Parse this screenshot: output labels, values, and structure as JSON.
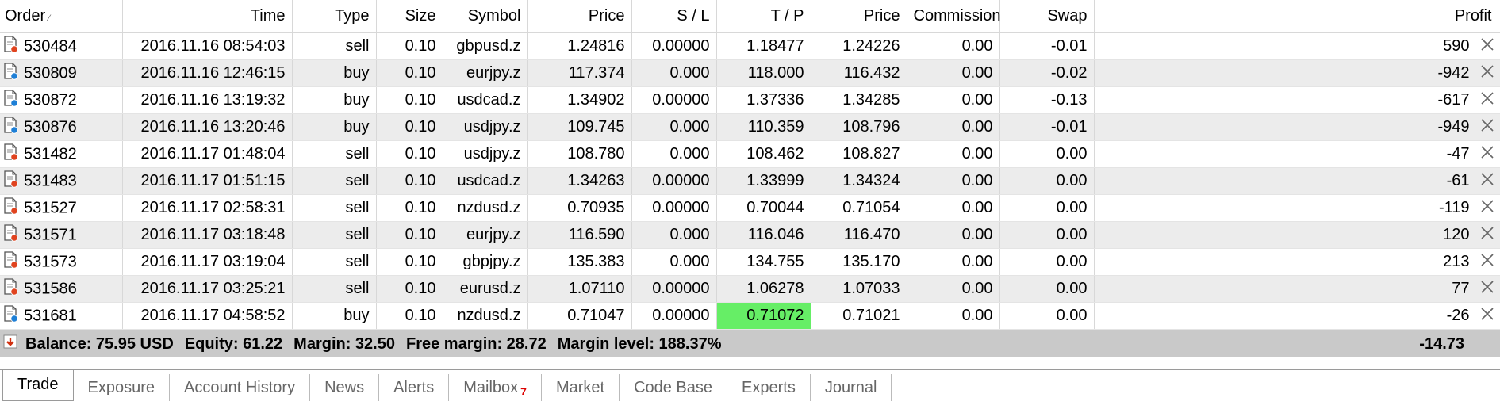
{
  "columns": [
    "Order",
    "Time",
    "Type",
    "Size",
    "Symbol",
    "Price",
    "S / L",
    "T / P",
    "Price",
    "Commission",
    "Swap",
    "Profit"
  ],
  "rows": [
    {
      "order": "530484",
      "time": "2016.11.16 08:54:03",
      "type": "sell",
      "size": "0.10",
      "symbol": "gbpusd.z",
      "price": "1.24816",
      "sl": "0.00000",
      "tp": "1.18477",
      "cur": "1.24226",
      "commission": "0.00",
      "swap": "-0.01",
      "profit": "590"
    },
    {
      "order": "530809",
      "time": "2016.11.16 12:46:15",
      "type": "buy",
      "size": "0.10",
      "symbol": "eurjpy.z",
      "price": "117.374",
      "sl": "0.000",
      "tp": "118.000",
      "cur": "116.432",
      "commission": "0.00",
      "swap": "-0.02",
      "profit": "-942"
    },
    {
      "order": "530872",
      "time": "2016.11.16 13:19:32",
      "type": "buy",
      "size": "0.10",
      "symbol": "usdcad.z",
      "price": "1.34902",
      "sl": "0.00000",
      "tp": "1.37336",
      "cur": "1.34285",
      "commission": "0.00",
      "swap": "-0.13",
      "profit": "-617"
    },
    {
      "order": "530876",
      "time": "2016.11.16 13:20:46",
      "type": "buy",
      "size": "0.10",
      "symbol": "usdjpy.z",
      "price": "109.745",
      "sl": "0.000",
      "tp": "110.359",
      "cur": "108.796",
      "commission": "0.00",
      "swap": "-0.01",
      "profit": "-949"
    },
    {
      "order": "531482",
      "time": "2016.11.17 01:48:04",
      "type": "sell",
      "size": "0.10",
      "symbol": "usdjpy.z",
      "price": "108.780",
      "sl": "0.000",
      "tp": "108.462",
      "cur": "108.827",
      "commission": "0.00",
      "swap": "0.00",
      "profit": "-47"
    },
    {
      "order": "531483",
      "time": "2016.11.17 01:51:15",
      "type": "sell",
      "size": "0.10",
      "symbol": "usdcad.z",
      "price": "1.34263",
      "sl": "0.00000",
      "tp": "1.33999",
      "cur": "1.34324",
      "commission": "0.00",
      "swap": "0.00",
      "profit": "-61"
    },
    {
      "order": "531527",
      "time": "2016.11.17 02:58:31",
      "type": "sell",
      "size": "0.10",
      "symbol": "nzdusd.z",
      "price": "0.70935",
      "sl": "0.00000",
      "tp": "0.70044",
      "cur": "0.71054",
      "commission": "0.00",
      "swap": "0.00",
      "profit": "-119"
    },
    {
      "order": "531571",
      "time": "2016.11.17 03:18:48",
      "type": "sell",
      "size": "0.10",
      "symbol": "eurjpy.z",
      "price": "116.590",
      "sl": "0.000",
      "tp": "116.046",
      "cur": "116.470",
      "commission": "0.00",
      "swap": "0.00",
      "profit": "120"
    },
    {
      "order": "531573",
      "time": "2016.11.17 03:19:04",
      "type": "sell",
      "size": "0.10",
      "symbol": "gbpjpy.z",
      "price": "135.383",
      "sl": "0.000",
      "tp": "134.755",
      "cur": "135.170",
      "commission": "0.00",
      "swap": "0.00",
      "profit": "213"
    },
    {
      "order": "531586",
      "time": "2016.11.17 03:25:21",
      "type": "sell",
      "size": "0.10",
      "symbol": "eurusd.z",
      "price": "1.07110",
      "sl": "0.00000",
      "tp": "1.06278",
      "cur": "1.07033",
      "commission": "0.00",
      "swap": "0.00",
      "profit": "77"
    },
    {
      "order": "531681",
      "time": "2016.11.17 04:58:52",
      "type": "buy",
      "size": "0.10",
      "symbol": "nzdusd.z",
      "price": "0.71047",
      "sl": "0.00000",
      "tp": "0.71072",
      "cur": "0.71021",
      "commission": "0.00",
      "swap": "0.00",
      "profit": "-26",
      "tp_highlight": true
    }
  ],
  "summary": {
    "balance": "Balance: 75.95 USD",
    "equity": "Equity: 61.22",
    "margin": "Margin: 32.50",
    "free_margin": "Free margin: 28.72",
    "margin_level": "Margin level: 188.37%",
    "total_profit": "-14.73"
  },
  "tabs": [
    {
      "label": "Trade",
      "active": true
    },
    {
      "label": "Exposure"
    },
    {
      "label": "Account History"
    },
    {
      "label": "News"
    },
    {
      "label": "Alerts"
    },
    {
      "label": "Mailbox",
      "badge": "7"
    },
    {
      "label": "Market"
    },
    {
      "label": "Code Base"
    },
    {
      "label": "Experts"
    },
    {
      "label": "Journal"
    }
  ],
  "colors": {
    "sell_icon": "#e0431f",
    "buy_icon": "#1e7fd6",
    "tp_highlight": "#66ee66",
    "summary_bg": "#c9c9c9",
    "badge": "#dd0000"
  },
  "icons": {
    "order_type": "order-document-icon",
    "close": "close-icon",
    "summary": "collapse-arrow-icon"
  }
}
